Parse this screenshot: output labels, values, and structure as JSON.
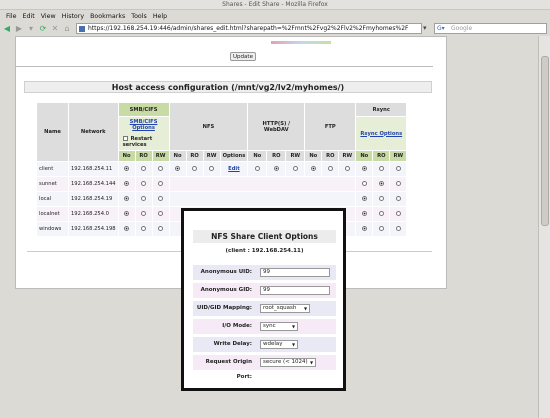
{
  "window": {
    "title": "Shares - Edit Share - Mozilla Firefox"
  },
  "menu": [
    "File",
    "Edit",
    "View",
    "History",
    "Bookmarks",
    "Tools",
    "Help"
  ],
  "nav": {
    "url": "https://192.168.254.19:446/admin/shares_edit.html?sharepath=%2Fmnt%2Fvg2%2Flv2%2Fmyhomes%2F",
    "search_placeholder": "Google"
  },
  "page": {
    "update_label": "Update",
    "host_access_title": "Host access configuration (/mnt/vg2/lv2/myhomes/)",
    "table": {
      "col_name": "Name",
      "col_network": "Network",
      "smb_header": "SMB/CIFS",
      "smb_options": "SMB/CIFS Options",
      "restart_services": "Restart services",
      "nfs_header": "NFS",
      "http_header": "HTTP(S) / WebDAV",
      "ftp_header": "FTP",
      "rsync_header": "Rsync",
      "rsync_options": "Rsync Options",
      "sub_no": "No",
      "sub_ro": "RO",
      "sub_rw": "RW",
      "sub_options": "Options",
      "edit_label": "Edit",
      "rows": [
        {
          "name": "client",
          "network": "192.168.254.11"
        },
        {
          "name": "sunnet",
          "network": "192.168.254.144"
        },
        {
          "name": "local",
          "network": "192.168.254.19"
        },
        {
          "name": "localnet",
          "network": "192.168.254.0"
        },
        {
          "name": "windows",
          "network": "192.168.254.198"
        }
      ]
    }
  },
  "popup": {
    "title": "NFS Share Client Options",
    "subtitle": "(client : 192.168.254.11)",
    "anon_uid_label": "Anonymous UID:",
    "anon_uid_value": "99",
    "anon_gid_label": "Anonymous GID:",
    "anon_gid_value": "99",
    "mapping_label": "UID/GID Mapping:",
    "mapping_value": "root_squash",
    "io_label": "I/O Mode:",
    "io_value": "sync",
    "write_label": "Write Delay:",
    "write_value": "wdelay",
    "port_label": "Request Origin Port:",
    "port_value": "secure (< 1024)"
  }
}
